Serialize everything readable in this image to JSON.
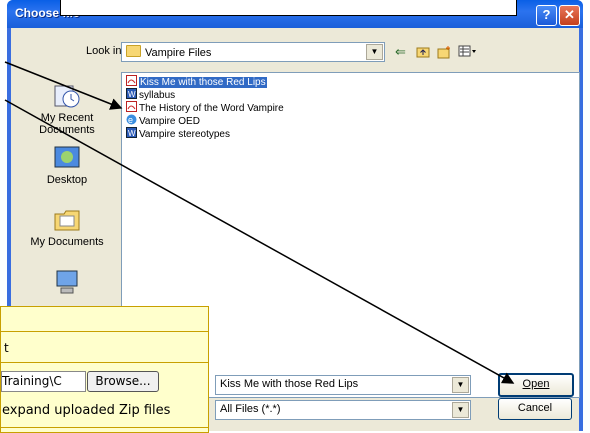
{
  "dialog": {
    "title": "Choose file",
    "help_symbol": "?",
    "close_symbol": "✕",
    "lookin_label": "Look in:",
    "lookin_value": "Vampire Files",
    "toolbar_icons": [
      "back-icon",
      "up-folder-icon",
      "new-folder-icon",
      "views-menu-icon"
    ],
    "places": [
      {
        "label": "My Recent Documents",
        "icon": "recent-documents-icon"
      },
      {
        "label": "Desktop",
        "icon": "desktop-icon"
      },
      {
        "label": "My Documents",
        "icon": "my-documents-icon"
      },
      {
        "label": "",
        "icon": "my-computer-icon"
      }
    ],
    "files": [
      {
        "name": "Kiss Me with those Red Lips",
        "icon": "pdf-icon",
        "selected": true
      },
      {
        "name": "syllabus",
        "icon": "word-doc-icon",
        "selected": false
      },
      {
        "name": "The History of the Word Vampire",
        "icon": "pdf-icon",
        "selected": false
      },
      {
        "name": "Vampire OED",
        "icon": "ie-html-icon",
        "selected": false
      },
      {
        "name": "Vampire stereotypes",
        "icon": "word-doc-icon",
        "selected": false
      }
    ],
    "filename_value": "Kiss Me with those Red Lips",
    "filetype_value": "All Files (*.*)",
    "open_label": "Open",
    "cancel_label": "Cancel"
  },
  "form": {
    "row1_text": "t",
    "path_value": "Training\\C",
    "browse_label": "Browse...",
    "expand_text": "expand uploaded Zip files"
  },
  "colors": {
    "titlebar": "#0a5fe6",
    "dialog_bg": "#ece9d8",
    "selection": "#316ac5",
    "form_bg": "#ffffcc"
  }
}
